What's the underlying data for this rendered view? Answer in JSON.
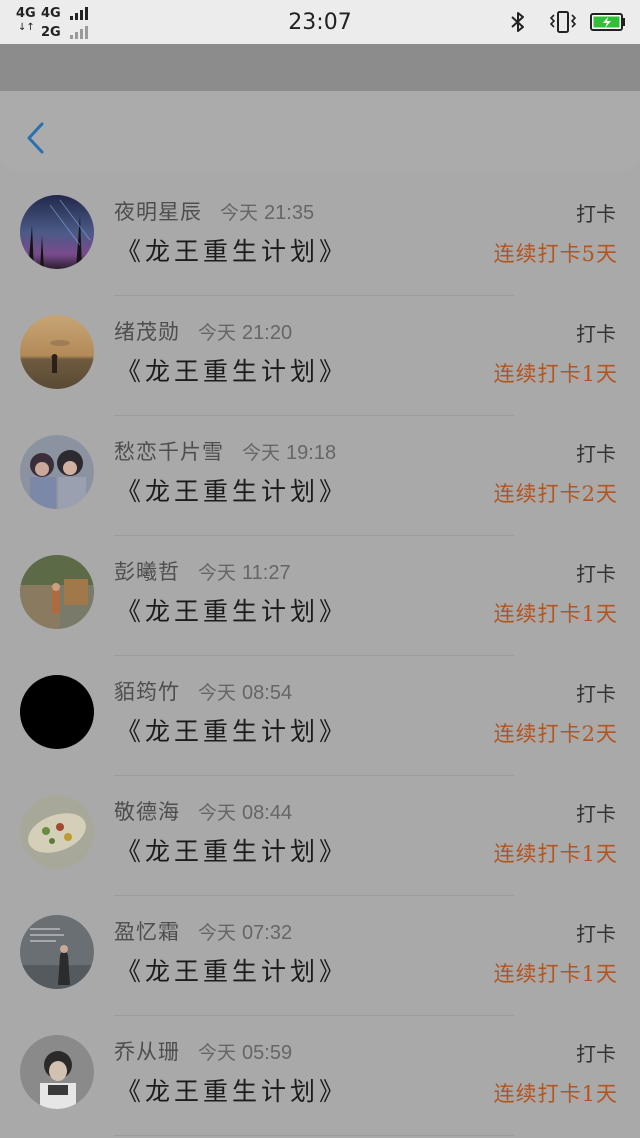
{
  "status_bar": {
    "network_top_1": "4G",
    "network_top_2": "4G",
    "network_bottom": "2G",
    "clock": "23:07",
    "icons": [
      "bluetooth-icon",
      "vibrate-icon",
      "battery-icon"
    ],
    "battery_color": "#2fbf3a"
  },
  "header": {
    "back_icon": "chevron-left-icon",
    "accent_color": "#2a6fb0"
  },
  "list": {
    "checkin_color": "#333333",
    "streak_color": "#b2551f",
    "items": [
      {
        "name": "夜明星辰",
        "day": "今天",
        "time": "21:35",
        "title": "《龙王重生计划》",
        "action": "打卡",
        "streak": "连续打卡5天"
      },
      {
        "name": "绪茂勋",
        "day": "今天",
        "time": "21:20",
        "title": "《龙王重生计划》",
        "action": "打卡",
        "streak": "连续打卡1天"
      },
      {
        "name": "愁恋千片雪",
        "day": "今天",
        "time": "19:18",
        "title": "《龙王重生计划》",
        "action": "打卡",
        "streak": "连续打卡2天"
      },
      {
        "name": "彭曦哲",
        "day": "今天",
        "time": "11:27",
        "title": "《龙王重生计划》",
        "action": "打卡",
        "streak": "连续打卡1天"
      },
      {
        "name": "貊筠竹",
        "day": "今天",
        "time": "08:54",
        "title": "《龙王重生计划》",
        "action": "打卡",
        "streak": "连续打卡2天"
      },
      {
        "name": "敬德海",
        "day": "今天",
        "time": "08:44",
        "title": "《龙王重生计划》",
        "action": "打卡",
        "streak": "连续打卡1天"
      },
      {
        "name": "盈忆霜",
        "day": "今天",
        "time": "07:32",
        "title": "《龙王重生计划》",
        "action": "打卡",
        "streak": "连续打卡1天"
      },
      {
        "name": "乔从珊",
        "day": "今天",
        "time": "05:59",
        "title": "《龙王重生计划》",
        "action": "打卡",
        "streak": "连续打卡1天"
      }
    ]
  }
}
